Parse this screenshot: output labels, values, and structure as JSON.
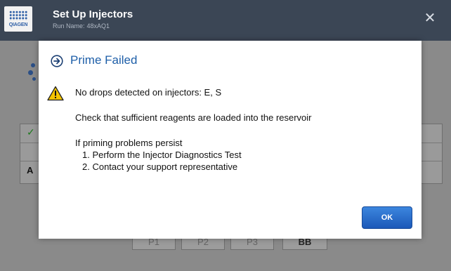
{
  "header": {
    "logo_text": "QIAGEN",
    "title": "Set Up Injectors",
    "run_label": "Run Name:",
    "run_name": "48xAQ1",
    "close_glyph": "✕"
  },
  "background": {
    "check_glyph": "✓",
    "row_label": "A",
    "injector_buttons": [
      "P1",
      "P2",
      "P3",
      "BB"
    ]
  },
  "dialog": {
    "title": "Prime Failed",
    "title_icon": "circle-arrow-right-icon",
    "warning_icon": "warning-triangle-icon",
    "message": "No drops detected on injectors: E, S",
    "check_text": "Check that sufficient reagents are loaded into the reservoir",
    "persist_text": "If priming problems persist",
    "steps": [
      "1. Perform the Injector Diagnostics Test",
      "2. Contact your support representative"
    ],
    "ok_label": "OK"
  },
  "colors": {
    "header_bg": "#3b4655",
    "title_blue": "#1d5ea8",
    "button_blue": "#2a6fce",
    "warning_yellow": "#f5c400"
  }
}
